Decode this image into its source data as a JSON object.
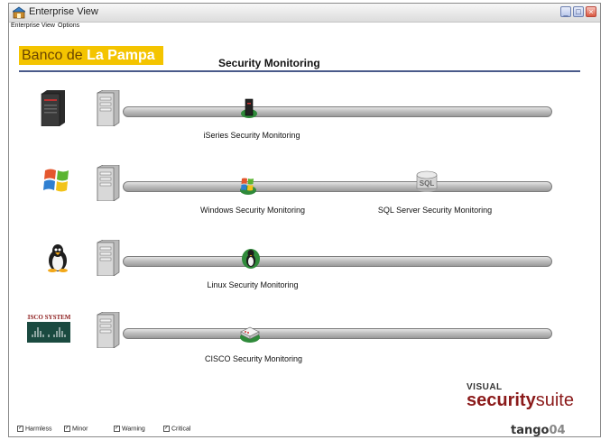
{
  "window": {
    "title": "Enterprise View"
  },
  "menu": [
    "Enterprise View",
    "Options"
  ],
  "branding": {
    "bank_part1": "Banco de ",
    "bank_part2": "La Pampa"
  },
  "page_title": "Security Monitoring",
  "rows": [
    {
      "os": "iseries-server-icon",
      "modules": [
        {
          "label": "iSeries Security Monitoring",
          "icon": "iseries-module-icon"
        }
      ]
    },
    {
      "os": "windows-logo-icon",
      "modules": [
        {
          "label": "Windows Security Monitoring",
          "icon": "windows-module-icon"
        },
        {
          "label": "SQL Server Security Monitoring",
          "icon": "sql-server-module-icon"
        }
      ]
    },
    {
      "os": "linux-tux-icon",
      "modules": [
        {
          "label": "Linux Security Monitoring",
          "icon": "linux-module-icon"
        }
      ]
    },
    {
      "os": "cisco-systems-logo",
      "cisco_text": "CISCO SYSTEMS",
      "modules": [
        {
          "label": "CISCO Security Monitoring",
          "icon": "cisco-router-module-icon"
        }
      ]
    }
  ],
  "product": {
    "visual": "VISUAL",
    "security": "security",
    "suite": "suite"
  },
  "vendor": {
    "name": "tango",
    "num": "04"
  },
  "legend": [
    {
      "label": "Harmless",
      "checked": true
    },
    {
      "label": "Minor",
      "checked": true
    },
    {
      "label": "Warning",
      "checked": true
    },
    {
      "label": "Critical",
      "checked": true
    }
  ],
  "window_controls": {
    "minimize": "_",
    "maximize": "□",
    "close": "×"
  },
  "checkmark": "✓",
  "colors": {
    "accent_rule": "#4a5a8a",
    "bank_yellow": "#f4c400",
    "product_red": "#8b1a1a"
  }
}
